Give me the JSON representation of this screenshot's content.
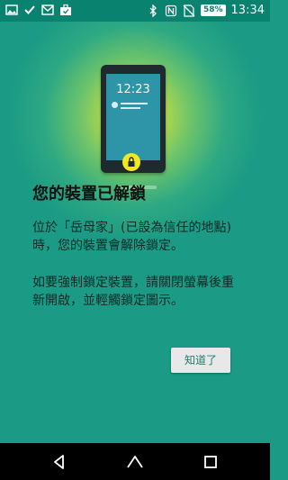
{
  "status_bar": {
    "battery": "58%",
    "time": "13:34",
    "left_icons": [
      "photo-notification-icon",
      "check-icon",
      "gmail-icon",
      "briefcase-icon"
    ],
    "right_icons": [
      "bluetooth-icon",
      "nfc-icon",
      "no-sim-icon",
      "battery-icon"
    ]
  },
  "illustration": {
    "phone_time": "12:23"
  },
  "dialog": {
    "title": "您的裝置已解鎖",
    "paragraph1": "位於「岳母家」(已設為信任的地點) 時，您的裝置會解除鎖定。",
    "paragraph2": "如要強制鎖定裝置，請關閉螢幕後重新開啟，並輕觸鎖定圖示。",
    "ok_button": "知道了"
  },
  "nav_bar": {
    "buttons": [
      "back-icon",
      "home-icon",
      "recents-icon"
    ]
  },
  "colors": {
    "background": "#1b9b85",
    "status_bar": "#0a8270",
    "button_text": "#1b7f6e",
    "lock_yellow": "#f2e81d"
  }
}
